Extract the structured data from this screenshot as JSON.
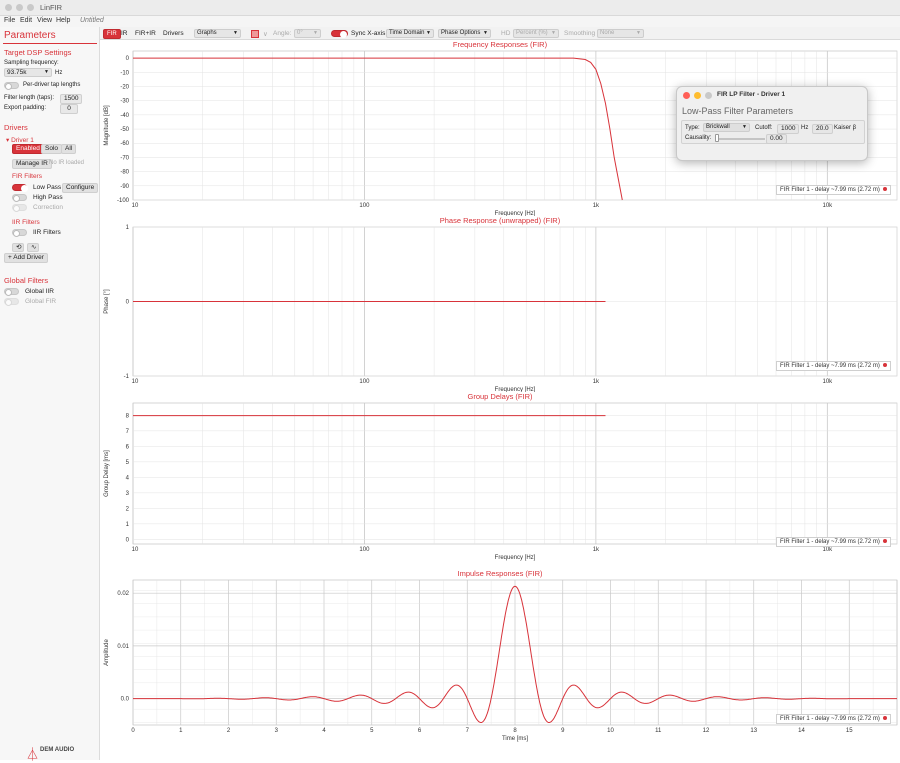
{
  "app": {
    "name": "LinFIR",
    "untitled": "Untitled"
  },
  "menu": [
    "File",
    "Edit",
    "View",
    "Help"
  ],
  "sidebar": {
    "heading": "Parameters",
    "target_dsp": "Target DSP Settings",
    "sampling_label": "Sampling frequency:",
    "sampling_value": "93.75k",
    "sampling_unit": "Hz",
    "per_driver_tap": "Per-driver tap lengths",
    "filter_length_label": "Filter length (taps):",
    "filter_length_value": "1500",
    "export_padding_label": "Export padding:",
    "export_padding_value": "0",
    "drivers_heading": "Drivers",
    "driver_name": "Driver 1",
    "enabled_btn": "Enabled",
    "solo_btn": "Solo",
    "all_btn": "All",
    "manage_ir_btn": "Manage IR",
    "no_ir": "No IR loaded",
    "fir_filters_heading": "FIR Filters",
    "low_pass": "Low Pass",
    "configure_btn": "Configure",
    "high_pass": "High Pass",
    "correction": "Correction",
    "iir_filters_heading": "IIR Filters",
    "iir_filters": "IIR Filters",
    "add_driver_btn": "+ Add Driver",
    "global_filters_heading": "Global Filters",
    "global_iir": "Global IIR",
    "global_fir": "Global FIR",
    "brand": "DEM AUDIO"
  },
  "toolbar": {
    "fir": "FIR",
    "ir": "IR",
    "fir_ir": "FIR+IR",
    "drivers": "Drivers",
    "graphs": "Graphs",
    "angle_label": "Angle:",
    "angle_value": "0°",
    "sync_x": "Sync X-axis",
    "time_domain": "Time Domain",
    "phase_options": "Phase Options",
    "hd": "HD",
    "percent": "Percent (%)",
    "smoothing": "Smoothing",
    "smoothing_value": "None"
  },
  "legend_text": "FIR Filter 1 - delay ~7.99 ms (2.72 m)",
  "colors": {
    "accent": "#d8333a",
    "grid": "#e3e3e3",
    "grid_major": "#c8c8c8"
  },
  "popup": {
    "title": "FIR LP Filter - Driver 1",
    "heading": "Low-Pass Filter Parameters",
    "type_label": "Type:",
    "type_value": "Brickwall",
    "cutoff_label": "Cutoff:",
    "cutoff_value": "1000",
    "cutoff_unit": "Hz",
    "kaiser_value": "20.0",
    "kaiser_label": "Kaiser β",
    "causality_label": "Causality:",
    "causality_value": "0.00"
  },
  "chart_data": [
    {
      "type": "line",
      "title": "Frequency Responses (FIR)",
      "xlabel": "Frequency [Hz]",
      "ylabel": "Magnitude [dB]",
      "x_scale": "log",
      "xlim": [
        10,
        20000
      ],
      "ylim": [
        -100,
        5
      ],
      "x_ticks": [
        "10",
        "100",
        "1k",
        "10k"
      ],
      "y_ticks": [
        "0",
        "-10",
        "-20",
        "-30",
        "-40",
        "-50",
        "-60",
        "-70",
        "-80",
        "-90",
        "-100"
      ],
      "series": [
        {
          "name": "FIR Filter 1 - delay ~7.99 ms (2.72 m)",
          "x": [
            10,
            100,
            500,
            800,
            900,
            950,
            1000,
            1050,
            1100,
            1150,
            1200,
            1300
          ],
          "y": [
            0,
            0,
            0,
            0,
            -1,
            -3,
            -8,
            -18,
            -32,
            -50,
            -70,
            -100
          ]
        }
      ]
    },
    {
      "type": "line",
      "title": "Phase Response (unwrapped) (FIR)",
      "xlabel": "Frequency [Hz]",
      "ylabel": "Phase [°]",
      "x_scale": "log",
      "xlim": [
        10,
        20000
      ],
      "ylim": [
        -1,
        1
      ],
      "x_ticks": [
        "10",
        "100",
        "1k",
        "10k"
      ],
      "y_ticks": [
        "1",
        "0",
        "-1"
      ],
      "series": [
        {
          "name": "FIR Filter 1 - delay ~7.99 ms (2.72 m)",
          "x": [
            10,
            100,
            1000,
            1100
          ],
          "y": [
            0,
            0,
            0,
            0
          ]
        }
      ]
    },
    {
      "type": "line",
      "title": "Group Delays (FIR)",
      "xlabel": "Frequency [Hz]",
      "ylabel": "Group Delay [ms]",
      "x_scale": "log",
      "xlim": [
        10,
        20000
      ],
      "ylim": [
        -0.3,
        8.8
      ],
      "x_ticks": [
        "10",
        "100",
        "1k",
        "10k"
      ],
      "y_ticks": [
        "0",
        "1",
        "2",
        "3",
        "4",
        "5",
        "6",
        "7",
        "8"
      ],
      "series": [
        {
          "name": "FIR Filter 1 - delay ~7.99 ms (2.72 m)",
          "x": [
            10,
            100,
            1000,
            1100
          ],
          "y": [
            7.99,
            7.99,
            7.99,
            7.99
          ]
        }
      ]
    },
    {
      "type": "line",
      "title": "Impulse Responses (FIR)",
      "xlabel": "Time [ms]",
      "ylabel": "Amplitude",
      "xlim": [
        0,
        16
      ],
      "ylim": [
        -0.005,
        0.0225
      ],
      "x_ticks": [
        "0",
        "1",
        "2",
        "3",
        "4",
        "5",
        "6",
        "7",
        "8",
        "9",
        "10",
        "11",
        "12",
        "13",
        "14",
        "15"
      ],
      "y_ticks": [
        "0.02",
        "0.01",
        "0.0"
      ],
      "series": [
        {
          "name": "FIR Filter 1 - delay ~7.99 ms (2.72 m)",
          "form": "sinc",
          "center_ms": 8.0,
          "peak": 0.0213,
          "cutoff_hz": 1000,
          "x_range": [
            0,
            16
          ]
        }
      ]
    }
  ]
}
